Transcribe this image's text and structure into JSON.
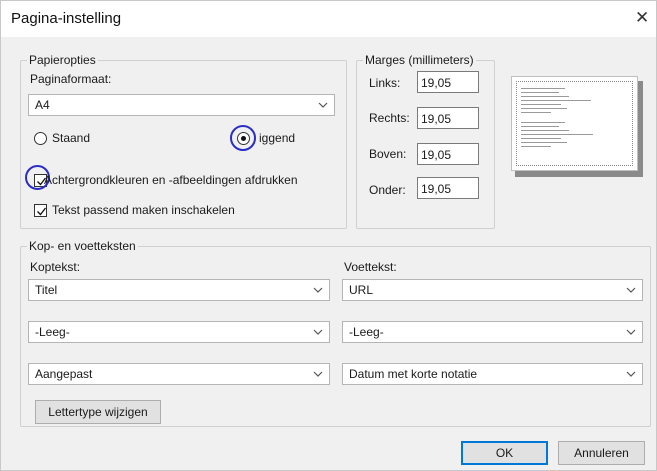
{
  "dialog": {
    "title": "Pagina-instelling",
    "close_icon": "close-icon"
  },
  "paper": {
    "legend": "Papieropties",
    "format_label": "Paginaformaat:",
    "format_value": "A4",
    "portrait_label": "Staand",
    "landscape_label": "Liggend",
    "landscape_visible_text": "iggend",
    "orientation_selected": "Liggend",
    "bg_print_label": "Achtergrondkleuren en -afbeeldingen afdrukken",
    "bg_print_checked": true,
    "shrink_label": "Tekst passend maken inschakelen",
    "shrink_checked": true
  },
  "margins": {
    "legend": "Marges (millimeters)",
    "left_label": "Links:",
    "left_value": "19,05",
    "right_label": "Rechts:",
    "right_value": "19,05",
    "top_label": "Boven:",
    "top_value": "19,05",
    "bottom_label": "Onder:",
    "bottom_value": "19,05"
  },
  "headers": {
    "legend": "Kop- en voetteksten",
    "header_label": "Koptekst:",
    "footer_label": "Voettekst:",
    "header_values": [
      "Titel",
      "-Leeg-",
      "Aangepast"
    ],
    "footer_values": [
      "URL",
      "-Leeg-",
      "Datum met korte notatie"
    ],
    "font_button": "Lettertype wijzigen"
  },
  "buttons": {
    "ok": "OK",
    "cancel": "Annuleren"
  },
  "colors": {
    "annotation_ring": "#2a2ec4",
    "default_button_border": "#0078d7"
  }
}
